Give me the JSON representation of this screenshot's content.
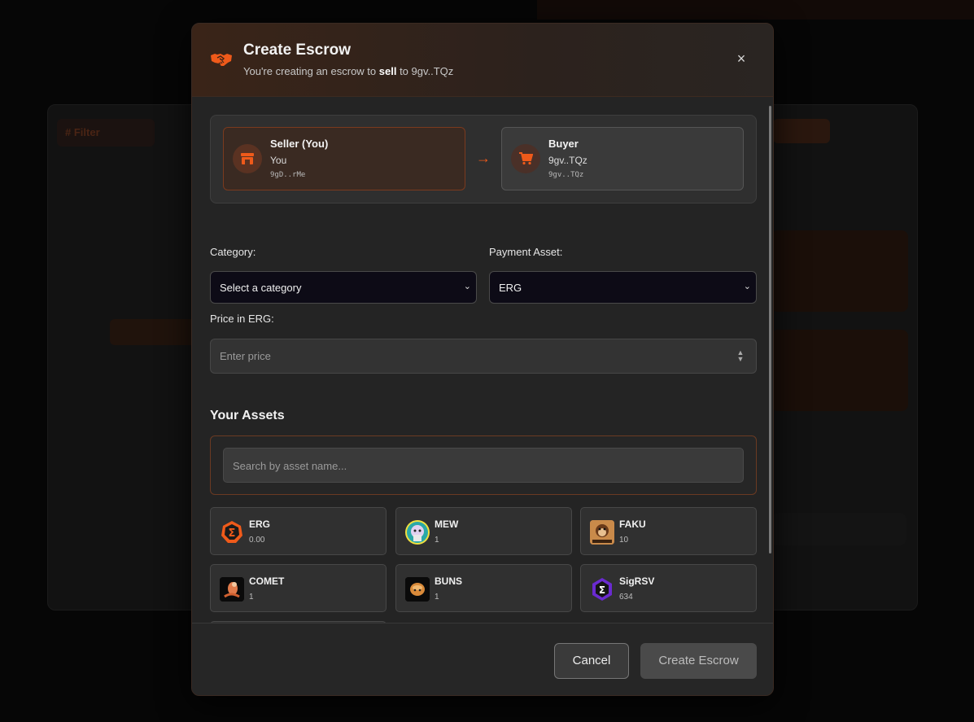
{
  "background": {
    "tab_label": "# Filter"
  },
  "modal": {
    "title": "Create Escrow",
    "subtitle_prefix": "You're creating an escrow to ",
    "subtitle_action": "sell",
    "subtitle_suffix": " to 9gv..TQz",
    "close_label": "×",
    "icon": "handshake-icon",
    "accent_color": "#ef5a1a"
  },
  "parties": {
    "seller": {
      "title": "Seller (You)",
      "name": "You",
      "address": "9gD..rMe",
      "icon": "store-icon"
    },
    "buyer": {
      "title": "Buyer",
      "name": "9gv..TQz",
      "address": "9gv..TQz",
      "icon": "cart-icon"
    },
    "arrow": "→"
  },
  "form": {
    "category_label": "Category:",
    "category_value": "Select a category",
    "payment_label": "Payment Asset:",
    "payment_value": "ERG",
    "price_label": "Price in ERG:",
    "price_placeholder": "Enter price"
  },
  "assets": {
    "title": "Your Assets",
    "search_placeholder": "Search by asset name...",
    "items": [
      {
        "name": "ERG",
        "balance": "0.00",
        "icon": "erg-token-icon"
      },
      {
        "name": "MEW",
        "balance": "1",
        "icon": "mew-token-icon"
      },
      {
        "name": "FAKU",
        "balance": "10",
        "icon": "faku-token-icon"
      },
      {
        "name": "COMET",
        "balance": "1",
        "icon": "comet-token-icon"
      },
      {
        "name": "BUNS",
        "balance": "1",
        "icon": "buns-token-icon"
      },
      {
        "name": "SigRSV",
        "balance": "634",
        "icon": "sigrsv-token-icon"
      }
    ]
  },
  "footer": {
    "cancel_label": "Cancel",
    "create_label": "Create Escrow"
  }
}
